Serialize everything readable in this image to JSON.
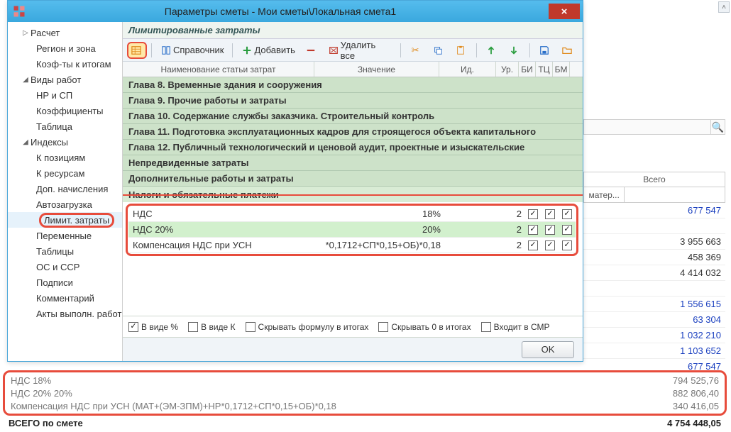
{
  "window": {
    "title": "Параметры сметы - Мои сметы\\Локальная смета1",
    "close": "×"
  },
  "nav": {
    "items": [
      {
        "label": "Расчет",
        "tw": "▷",
        "lvl": 1
      },
      {
        "label": "Регион и зона",
        "lvl": 2
      },
      {
        "label": "Коэф-ты к итогам",
        "lvl": 2
      },
      {
        "label": "Виды работ",
        "tw": "◢",
        "lvl": 1
      },
      {
        "label": "НР и СП",
        "lvl": 2
      },
      {
        "label": "Коэффициенты",
        "lvl": 2
      },
      {
        "label": "Таблица",
        "lvl": 2
      },
      {
        "label": "Индексы",
        "tw": "◢",
        "lvl": 1
      },
      {
        "label": "К позициям",
        "lvl": 2
      },
      {
        "label": "К ресурсам",
        "lvl": 2
      },
      {
        "label": "Доп. начисления",
        "lvl": 2
      },
      {
        "label": "Автозагрузка",
        "lvl": 2
      },
      {
        "label": "Лимит. затраты",
        "lvl": 2,
        "selected": true,
        "highlight": true
      },
      {
        "label": "Переменные",
        "lvl": 2
      },
      {
        "label": "Таблицы",
        "lvl": 2
      },
      {
        "label": "ОС и ССР",
        "lvl": 2
      },
      {
        "label": "Подписи",
        "lvl": 2
      },
      {
        "label": "Комментарий",
        "lvl": 2
      },
      {
        "label": "Акты выполн. работ",
        "lvl": 2
      }
    ]
  },
  "section_title": "Лимитированные затраты",
  "toolbar": {
    "reference": "Справочник",
    "add": "Добавить",
    "delete_all": "Удалить все"
  },
  "grid_headers": {
    "name": "Наименование статьи затрат",
    "val": "Значение",
    "id": "Ид.",
    "ur": "Ур.",
    "bi": "БИ",
    "tc": "ТЦ",
    "bm": "БМ"
  },
  "chapters": [
    "Глава 8. Временные здания и сооружения",
    "Глава 9. Прочие работы и затраты",
    "Глава 10. Содержание службы заказчика. Строительный контроль",
    "Глава 11. Подготовка эксплуатационных кадров для строящегося объекта капитального",
    "Глава 12. Публичный технологический и ценовой аудит, проектные и изыскательские",
    "Непредвиденные затраты",
    "Дополнительные работы и затраты"
  ],
  "cut_row": "Налоги и обязательные платежи",
  "rows": [
    {
      "name": "НДС",
      "val": "18%",
      "id": "",
      "ur": "2",
      "bi": true,
      "tc": true,
      "bm": true
    },
    {
      "name": "НДС 20%",
      "val": "20%",
      "id": "",
      "ur": "2",
      "bi": true,
      "tc": true,
      "bm": true,
      "sel": true
    },
    {
      "name": "Компенсация НДС при УСН",
      "val": "*0,1712+СП*0,15+ОБ)*0,18",
      "id": "",
      "ur": "2",
      "bi": true,
      "tc": true,
      "bm": true
    }
  ],
  "opts": {
    "pct": "В виде %",
    "coef": "В виде К",
    "hide_formula": "Скрывать формулу в итогах",
    "hide_zero": "Скрывать 0 в итогах",
    "in_smr": "Входит в СМР"
  },
  "ok": "OK",
  "bg": {
    "total_header": "Всего",
    "mat_header": "матер...",
    "vals": [
      "677 547",
      "",
      "3 955 663",
      "458 369",
      "4 414 032",
      "",
      "1 556 615",
      "63 304",
      "1 032 210",
      "1 103 652",
      "677 547"
    ]
  },
  "bottom": {
    "rows": [
      {
        "lbl": "НДС 18%",
        "num": "794 525,76"
      },
      {
        "lbl": "НДС 20% 20%",
        "num": "882 806,40"
      },
      {
        "lbl": "Компенсация НДС при УСН (МАТ+(ЭМ-ЗПМ)+НР*0,1712+СП*0,15+ОБ)*0,18",
        "num": "340 416,05"
      }
    ],
    "total_lbl": "ВСЕГО по смете",
    "total_num": "4 754 448,05"
  }
}
